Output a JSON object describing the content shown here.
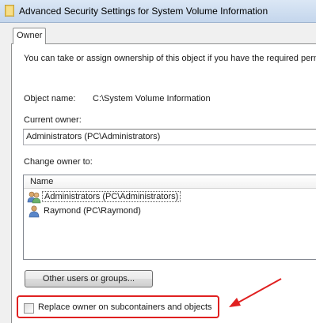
{
  "window": {
    "title": "Advanced Security Settings for System Volume Information"
  },
  "tabs": [
    {
      "label": "Owner"
    }
  ],
  "owner_tab": {
    "intro": "You can take or assign ownership of this object if you have the required permis",
    "object_name_label": "Object name:",
    "object_name_value": "C:\\System Volume Information",
    "current_owner_label": "Current owner:",
    "current_owner_value": "Administrators (PC\\Administrators)",
    "change_owner_label": "Change owner to:",
    "list": {
      "column_header": "Name",
      "items": [
        {
          "label": "Administrators (PC\\Administrators)",
          "icon": "user-group-icon",
          "selected": true
        },
        {
          "label": "Raymond (PC\\Raymond)",
          "icon": "user-icon",
          "selected": false
        }
      ]
    },
    "other_users_button": "Other users or groups...",
    "replace_owner_checkbox": {
      "label": "Replace owner on subcontainers and objects",
      "checked": false
    }
  },
  "colors": {
    "annotation": "#e02020",
    "titlebar": "#c4d6ec"
  }
}
